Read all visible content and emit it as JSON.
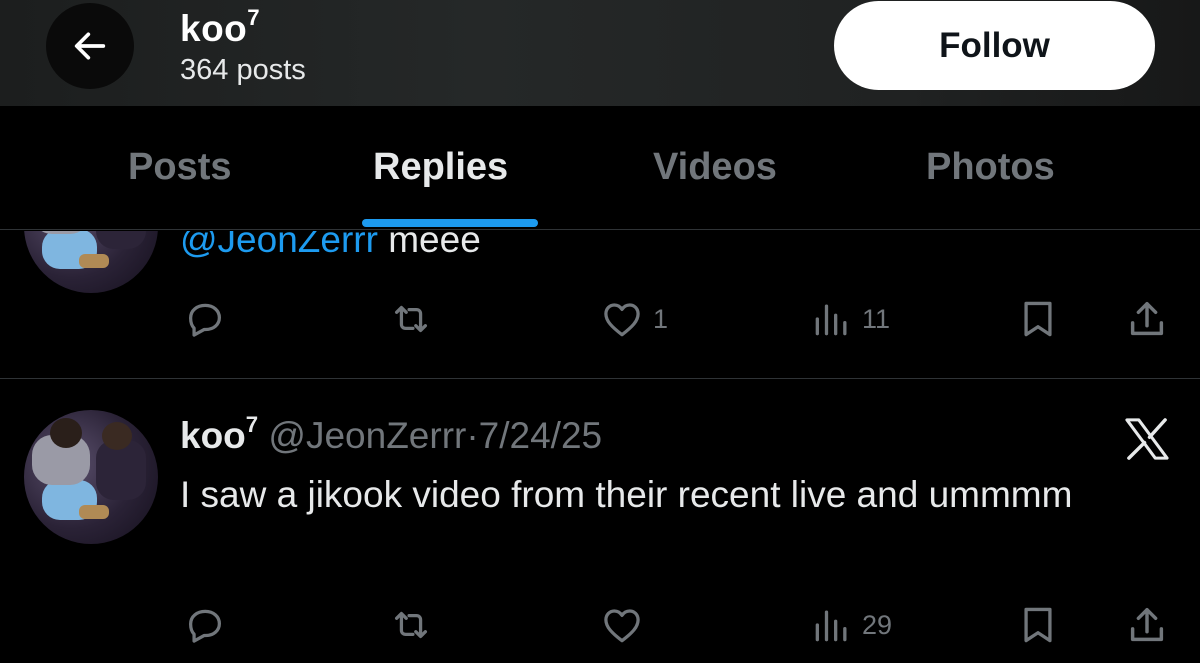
{
  "header": {
    "name": "koo",
    "name_suffix": "7",
    "post_count": "364 posts",
    "follow_label": "Follow"
  },
  "tabs": [
    {
      "label": "Posts"
    },
    {
      "label": "Replies",
      "active": true
    },
    {
      "label": "Videos"
    },
    {
      "label": "Photos"
    }
  ],
  "tweets": [
    {
      "mention": "@JeonZerrr",
      "text": " meee",
      "likes": "1",
      "views": "11"
    },
    {
      "name": "koo",
      "name_suffix": "7",
      "handle": "@JeonZerrr",
      "separator": "·",
      "date": "7/24/25",
      "text": "I saw a jikook video from their recent live and ummmm",
      "views": "29"
    }
  ],
  "colors": {
    "accent": "#1d9bf0",
    "muted": "#71767b",
    "text": "#e7e9ea",
    "background": "#000000"
  },
  "icons": [
    "back-arrow-icon",
    "reply-icon",
    "repost-icon",
    "like-icon",
    "views-icon",
    "bookmark-icon",
    "share-icon",
    "x-logo-icon"
  ]
}
